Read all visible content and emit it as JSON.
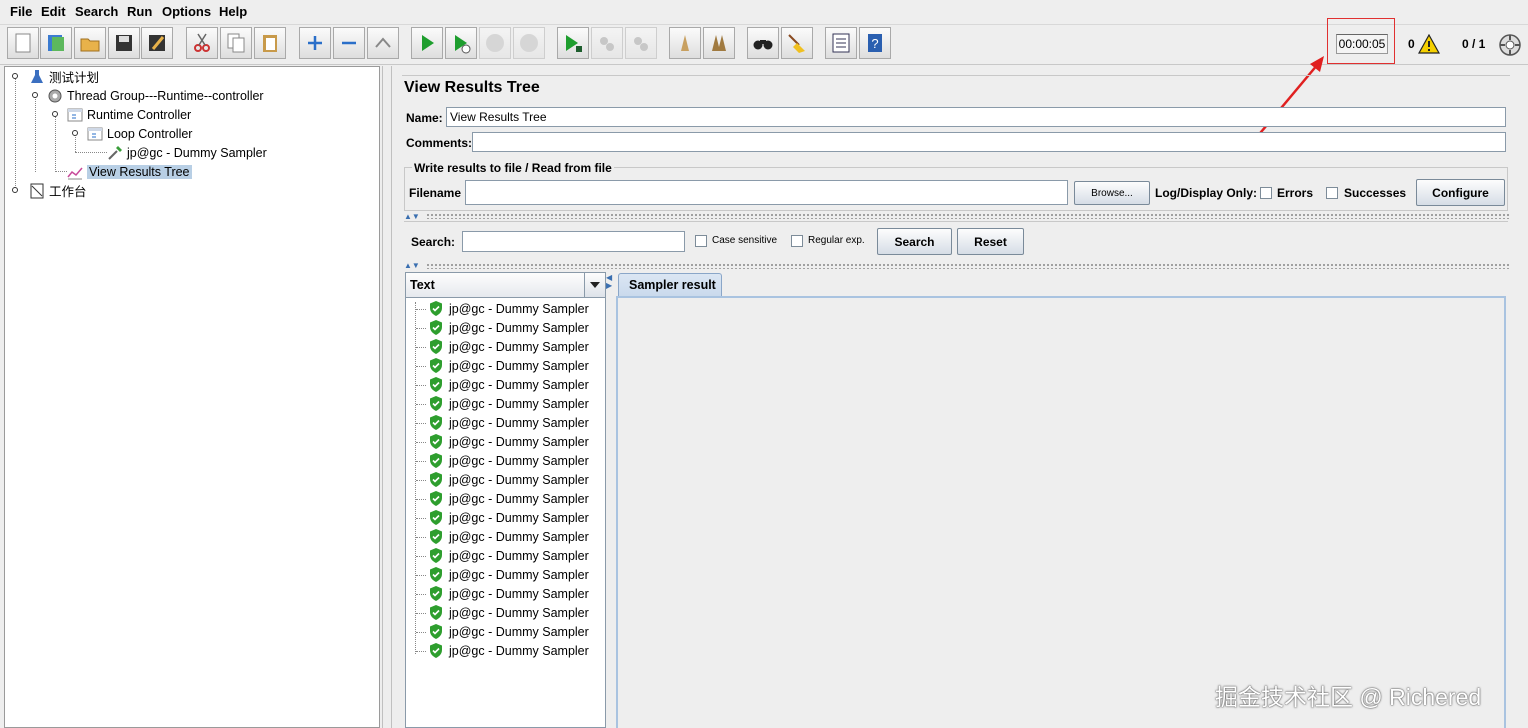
{
  "menu": [
    "File",
    "Edit",
    "Search",
    "Run",
    "Options",
    "Help"
  ],
  "toolbar": {
    "buttons": [
      "new-icon",
      "templates-icon",
      "open-icon",
      "save-icon",
      "save-as-icon",
      "cut-icon",
      "copy-icon",
      "paste-icon",
      "expand-icon",
      "collapse-icon",
      "toggle-icon",
      "start-icon",
      "start-no-pauses-icon",
      "stop-icon",
      "shutdown-icon",
      "remote-start-all-icon",
      "remote-stop-all-icon",
      "remote-shutdown-all-icon",
      "clear-icon",
      "clear-all-icon",
      "search-icon",
      "reset-search-icon",
      "function-helper-icon",
      "help-icon"
    ],
    "timer": "00:00:05",
    "warnings": "0",
    "threads": "0 / 1"
  },
  "tree": {
    "nodes": [
      "测试计划",
      "Thread Group---Runtime--controller",
      "Runtime Controller",
      "Loop Controller",
      "jp@gc - Dummy Sampler",
      "View Results Tree",
      "工作台"
    ]
  },
  "panel": {
    "title": "View Results Tree",
    "name_label": "Name:",
    "name_value": "View Results Tree",
    "comments_label": "Comments:",
    "comments_value": "",
    "file_group_title": "Write results to file / Read from file",
    "filename_label": "Filename",
    "filename_value": "",
    "browse_label": "Browse...",
    "log_display_label": "Log/Display Only:",
    "errors_label": "Errors",
    "successes_label": "Successes",
    "configure_label": "Configure"
  },
  "search": {
    "label": "Search:",
    "value": "",
    "case_sensitive_label": "Case sensitive",
    "regex_label": "Regular exp.",
    "search_button": "Search",
    "reset_button": "Reset"
  },
  "results": {
    "renderer": "Text",
    "items": [
      "jp@gc - Dummy Sampler",
      "jp@gc - Dummy Sampler",
      "jp@gc - Dummy Sampler",
      "jp@gc - Dummy Sampler",
      "jp@gc - Dummy Sampler",
      "jp@gc - Dummy Sampler",
      "jp@gc - Dummy Sampler",
      "jp@gc - Dummy Sampler",
      "jp@gc - Dummy Sampler",
      "jp@gc - Dummy Sampler",
      "jp@gc - Dummy Sampler",
      "jp@gc - Dummy Sampler",
      "jp@gc - Dummy Sampler",
      "jp@gc - Dummy Sampler",
      "jp@gc - Dummy Sampler",
      "jp@gc - Dummy Sampler",
      "jp@gc - Dummy Sampler",
      "jp@gc - Dummy Sampler",
      "jp@gc - Dummy Sampler"
    ],
    "tab": "Sampler result"
  },
  "watermark": "掘金技术社区 @ Richered",
  "colors": {
    "highlight_box": "#e03030",
    "arrow": "#e02020",
    "selection": "#b8cfe5",
    "success_green": "#2e9e2e"
  }
}
